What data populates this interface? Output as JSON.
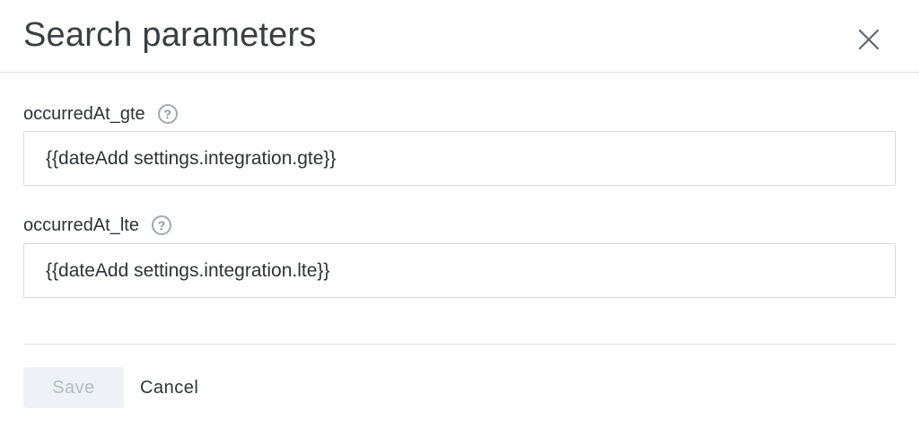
{
  "dialog": {
    "title": "Search parameters"
  },
  "fields": [
    {
      "label": "occurredAt_gte",
      "help_glyph": "?",
      "value": "{{dateAdd settings.integration.gte}}"
    },
    {
      "label": "occurredAt_lte",
      "help_glyph": "?",
      "value": "{{dateAdd settings.integration.lte}}"
    }
  ],
  "footer": {
    "save_label": "Save",
    "cancel_label": "Cancel"
  },
  "icons": {
    "close": "close-icon",
    "help": "question-circle-icon"
  },
  "colors": {
    "text": "#2e3338",
    "border": "#d6dadf",
    "divider": "#dde1e5",
    "save_disabled_bg": "#eef2f6",
    "save_disabled_text": "#b3bcc6",
    "help_icon": "#a2a9b0"
  }
}
